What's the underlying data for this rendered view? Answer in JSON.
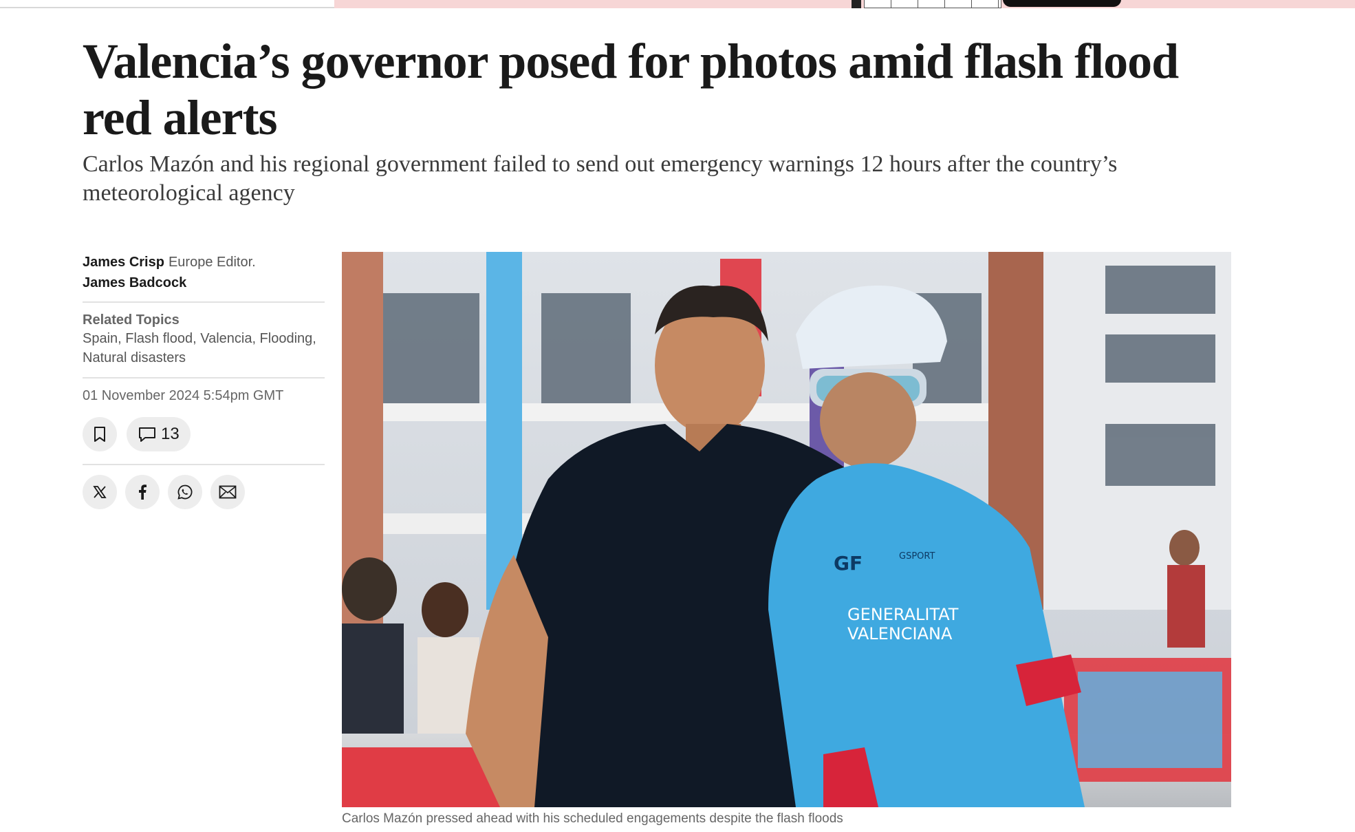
{
  "article": {
    "headline": "Valencia’s governor posed for photos amid flash flood red alerts",
    "standfirst": "Carlos Mazón and his regional government failed to send out emergency warnings 12 hours after the country’s meteorological agency",
    "authors": [
      {
        "name": "James Crisp",
        "role": "Europe Editor."
      },
      {
        "name": "James Badcock",
        "role": ""
      }
    ],
    "related_topics_label": "Related Topics",
    "related_topics": "Spain, Flash flood, Valencia, Flooding, Natural disasters",
    "date": "01 November 2024 5:54pm GMT",
    "comment_count": "13",
    "image_caption": "Carlos Mazón pressed ahead with his scheduled engagements despite the flash floods",
    "jersey_text_1": "GENERALITAT",
    "jersey_text_2": "VALENCIANA",
    "jersey_brand": "GSPORT",
    "jersey_logo": "GF"
  },
  "icons": {
    "bookmark": "bookmark-icon",
    "comment": "comment-icon",
    "x": "x-icon",
    "facebook": "facebook-icon",
    "whatsapp": "whatsapp-icon",
    "email": "email-icon"
  },
  "colors": {
    "ad_strip": "#f7d6d6",
    "text": "#1a1a1a",
    "muted": "#666666",
    "button_bg": "#ededed",
    "jersey_blue": "#3fa9e0"
  }
}
